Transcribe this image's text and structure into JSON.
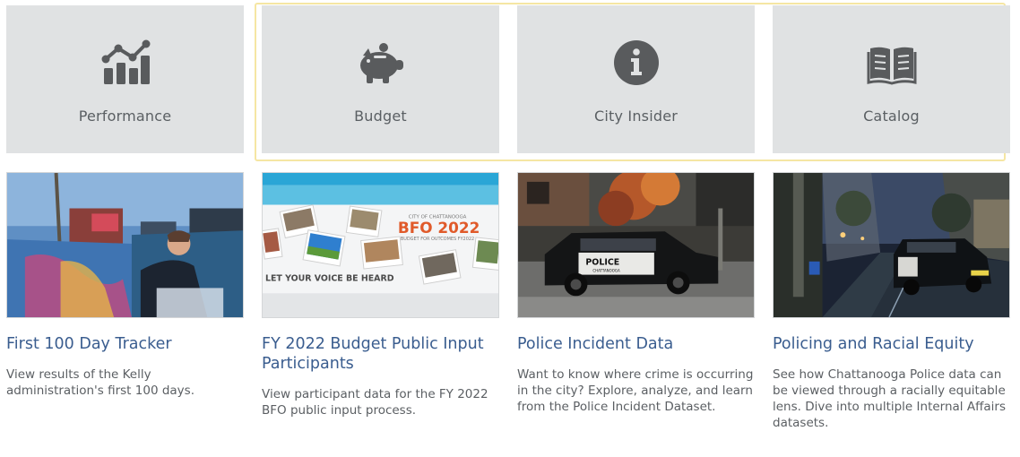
{
  "tiles": [
    {
      "label": "Performance",
      "icon": "chart-line-up-icon"
    },
    {
      "label": "Budget",
      "icon": "piggy-bank-icon"
    },
    {
      "label": "City Insider",
      "icon": "info-circle-icon"
    },
    {
      "label": "Catalog",
      "icon": "open-book-icon"
    }
  ],
  "cards": [
    {
      "title": "First 100 Day Tracker",
      "description": "View results of the Kelly administration's first 100 days."
    },
    {
      "title": "FY 2022 Budget Public Input Participants",
      "description": "View participant data for the FY 2022 BFO public input process.",
      "image_text": {
        "city": "CITY OF CHATTANOOGA",
        "heading": "BFO 2022",
        "tagline": "BUDGET FOR OUTCOMES FY2022",
        "banner": "LET YOUR VOICE BE HEARD"
      }
    },
    {
      "title": "Police Incident Data",
      "description": "Want to know where crime is occurring in the city? Explore, analyze, and learn from the Police Incident Dataset.",
      "image_text": {
        "door": "POLICE",
        "sub": "CHATTANOOGA"
      }
    },
    {
      "title": "Policing and Racial Equity",
      "description": "See how Chattanooga Police data can be viewed through a racially equitable lens. Dive into multiple Internal Affairs datasets."
    }
  ],
  "colors": {
    "tile_bg": "#e0e2e3",
    "icon": "#595b5d",
    "title_link": "#3a5d8f",
    "highlight": "#f5e6a3"
  }
}
